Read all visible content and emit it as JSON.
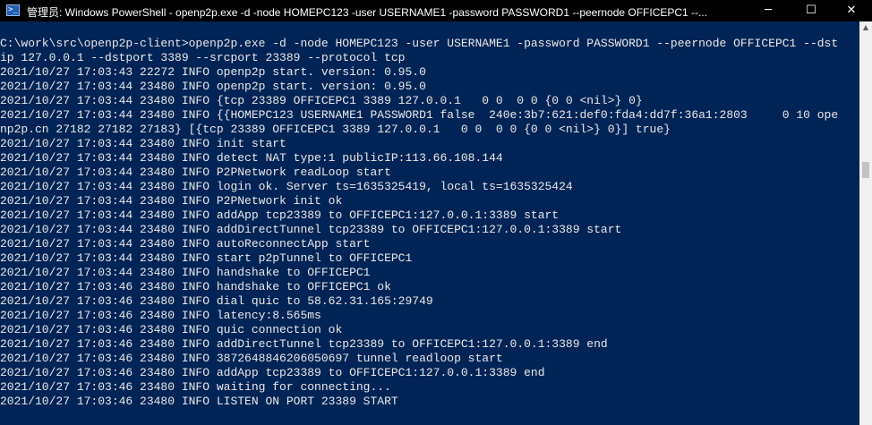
{
  "window": {
    "title": "管理员: Windows PowerShell - openp2p.exe  -d -node HOMEPC123 -user USERNAME1 -password PASSWORD1 --peernode OFFICEPC1 --...",
    "icon": "powershell-icon",
    "minimize_glyph": "─",
    "maximize_glyph": "☐",
    "close_glyph": "✕"
  },
  "scrollbar": {
    "up_glyph": "▲"
  },
  "console": {
    "lines": [
      "C:\\work\\src\\openp2p-client>openp2p.exe -d -node HOMEPC123 -user USERNAME1 -password PASSWORD1 --peernode OFFICEPC1 --dst",
      "ip 127.0.0.1 --dstport 3389 --srcport 23389 --protocol tcp",
      "2021/10/27 17:03:43 22272 INFO openp2p start. version: 0.95.0",
      "2021/10/27 17:03:44 23480 INFO openp2p start. version: 0.95.0",
      "2021/10/27 17:03:44 23480 INFO {tcp 23389 OFFICEPC1 3389 127.0.0.1   0 0  0 0 {0 0 <nil>} 0}",
      "2021/10/27 17:03:44 23480 INFO {{HOMEPC123 USERNAME1 PASSWORD1 false  240e:3b7:621:def0:fda4:dd7f:36a1:2803     0 10 ope",
      "np2p.cn 27182 27182 27183} [{tcp 23389 OFFICEPC1 3389 127.0.0.1   0 0  0 0 {0 0 <nil>} 0}] true}",
      "2021/10/27 17:03:44 23480 INFO init start",
      "2021/10/27 17:03:44 23480 INFO detect NAT type:1 publicIP:113.66.108.144",
      "2021/10/27 17:03:44 23480 INFO P2PNetwork readLoop start",
      "2021/10/27 17:03:44 23480 INFO login ok. Server ts=1635325419, local ts=1635325424",
      "2021/10/27 17:03:44 23480 INFO P2PNetwork init ok",
      "2021/10/27 17:03:44 23480 INFO addApp tcp23389 to OFFICEPC1:127.0.0.1:3389 start",
      "2021/10/27 17:03:44 23480 INFO addDirectTunnel tcp23389 to OFFICEPC1:127.0.0.1:3389 start",
      "2021/10/27 17:03:44 23480 INFO autoReconnectApp start",
      "2021/10/27 17:03:44 23480 INFO start p2pTunnel to OFFICEPC1",
      "2021/10/27 17:03:44 23480 INFO handshake to OFFICEPC1",
      "2021/10/27 17:03:46 23480 INFO handshake to OFFICEPC1 ok",
      "2021/10/27 17:03:46 23480 INFO dial quic to 58.62.31.165:29749",
      "2021/10/27 17:03:46 23480 INFO latency:8.565ms",
      "2021/10/27 17:03:46 23480 INFO quic connection ok",
      "2021/10/27 17:03:46 23480 INFO addDirectTunnel tcp23389 to OFFICEPC1:127.0.0.1:3389 end",
      "2021/10/27 17:03:46 23480 INFO 3872648846206050697 tunnel readloop start",
      "2021/10/27 17:03:46 23480 INFO addApp tcp23389 to OFFICEPC1:127.0.0.1:3389 end",
      "2021/10/27 17:03:46 23480 INFO waiting for connecting...",
      "2021/10/27 17:03:46 23480 INFO LISTEN ON PORT 23389 START"
    ]
  }
}
